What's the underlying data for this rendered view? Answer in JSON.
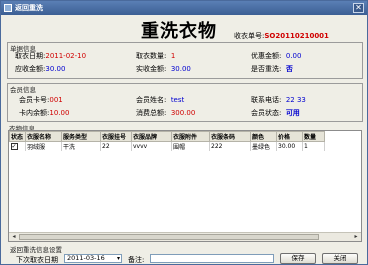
{
  "window": {
    "title": "返回重洗",
    "close_glyph": "✕"
  },
  "header": {
    "title": "重洗衣物",
    "order_label": "收衣单号:",
    "order_value": "SO20110210001"
  },
  "order_info": {
    "title": "单据信息",
    "receive_date_label": "取衣日期:",
    "receive_date": "2011-02-10",
    "quantity_label": "取衣数量:",
    "quantity": "1",
    "discount_label": "优惠金额:",
    "discount": "0.00",
    "receivable_label": "应收金额:",
    "receivable": "30.00",
    "received_label": "实收金额:",
    "received": "30.00",
    "rewash_label": "是否重洗:",
    "rewash": "否"
  },
  "member_info": {
    "title": "会员信息",
    "card_no_label": "会员卡号:",
    "card_no": "001",
    "name_label": "会员姓名:",
    "name": "test",
    "phone_label": "联系电话:",
    "phone": "22 33",
    "balance_label": "卡内余额:",
    "balance": "10.00",
    "total_label": "消费总额:",
    "total": "300.00",
    "status_label": "会员状态:",
    "status": "可用"
  },
  "clothes": {
    "title": "衣物信息",
    "columns": [
      "状态",
      "衣服名称",
      "服务类型",
      "衣服挂号",
      "衣服品牌",
      "衣服附件",
      "衣服条码",
      "颜色",
      "价格",
      "数量"
    ],
    "rows": [
      {
        "checked": true,
        "cells": [
          "羽绒服",
          "干洗",
          "22",
          "vvvv",
          "围帽",
          "222",
          "墨绿色",
          "30.00",
          "1"
        ]
      }
    ]
  },
  "footer": {
    "title": "返回重洗信息设置",
    "next_date_label": "下次取衣日期",
    "next_date": "2011-03-16",
    "remark_label": "备注:",
    "remark": "",
    "save_label": "保存",
    "close_label": "关闭"
  }
}
